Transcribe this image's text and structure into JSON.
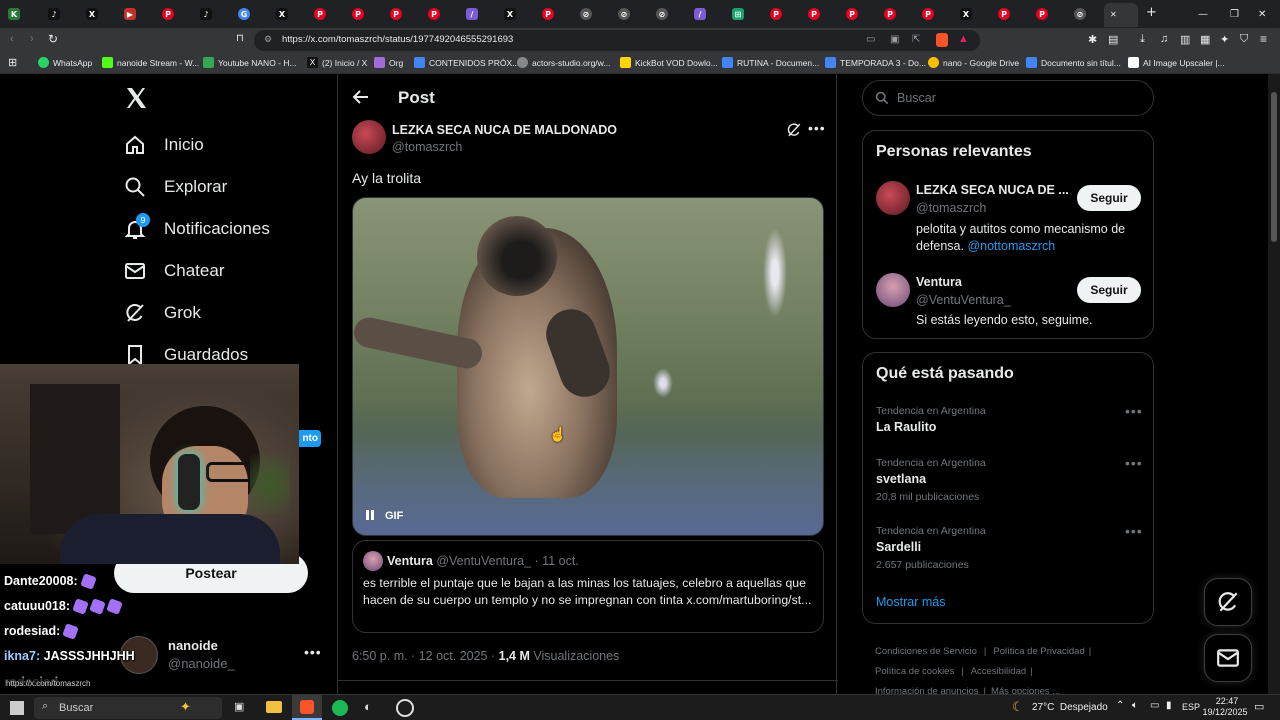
{
  "browser": {
    "url": "https://x.com/tomaszrch/status/1977492046555291693",
    "bookmarks": [
      "WhatsApp",
      "nanoide Stream - W...",
      "Youtube NANO - H...",
      "(2) Inicio / X",
      "Org",
      "CONTENIDOS PRÓX...",
      "actors-studio.org/w...",
      "KickBot VOD Dowlo...",
      "RUTINA - Documen...",
      "TEMPORADA 3 - Do...",
      "nano - Google Drive",
      "Documento sin títul...",
      "AI Image Upscaler |..."
    ]
  },
  "nav": {
    "items": [
      {
        "label": "Inicio",
        "icon": "home-icon"
      },
      {
        "label": "Explorar",
        "icon": "search-icon"
      },
      {
        "label": "Notificaciones",
        "icon": "bell-icon",
        "badge": "9"
      },
      {
        "label": "Chatear",
        "icon": "mail-icon"
      },
      {
        "label": "Grok",
        "icon": "grok-icon"
      },
      {
        "label": "Guardados",
        "icon": "bookmark-icon"
      }
    ],
    "post_button": "Postear",
    "badge_partial": "nto",
    "account": {
      "name": "nanoide",
      "handle": "@nanoide_"
    }
  },
  "post": {
    "header_title": "Post",
    "author_name": "LEZKA SECA NUCA DE MALDONADO",
    "author_handle": "@tomaszrch",
    "text": "Ay la trolita",
    "gif_label": "GIF",
    "quote": {
      "name": "Ventura",
      "handle": "@VentuVentura_",
      "date": "· 11 oct.",
      "text": "es terrible el puntaje que le bajan a las minas los tatuajes, celebro a aquellas que hacen de su cuerpo un templo y no se impregnan con tinta x.com/martuboring/st..."
    },
    "time": "6:50 p. m. · 12 oct. 2025 ·",
    "views_count": "1,4 M",
    "views_label": "Visualizaciones"
  },
  "sidebar": {
    "search_placeholder": "Buscar",
    "relevant_title": "Personas relevantes",
    "people": [
      {
        "name": "LEZKA SECA NUCA DE ...",
        "handle": "@tomaszrch",
        "bio": "pelotita y autitos como mecanismo de",
        "bio2": "defensa.",
        "bio_link": "@nottomaszrch",
        "button": "Seguir"
      },
      {
        "name": "Ventura",
        "handle": "@VentuVentura_",
        "bio": "Si estás leyendo esto, seguime.",
        "button": "Seguir"
      }
    ],
    "trending_title": "Qué está pasando",
    "trends": [
      {
        "meta": "Tendencia en Argentina",
        "name": "La Raulito",
        "count": ""
      },
      {
        "meta": "Tendencia en Argentina",
        "name": "svetlana",
        "count": "20,8 mil publicaciones"
      },
      {
        "meta": "Tendencia en Argentina",
        "name": "Sardelli",
        "count": "2.657 publicaciones"
      }
    ],
    "show_more": "Mostrar más",
    "footer": [
      "Condiciones de Servicio",
      "Política de Privacidad",
      "Política de cookies",
      "Accesibilidad",
      "Información de anuncios",
      "Más opciones ..."
    ]
  },
  "stream_chat": [
    {
      "user": "Dante20008:",
      "color": "#ffffff",
      "text": "",
      "emotes": 1
    },
    {
      "user": "catuuu018:",
      "color": "#ffffff",
      "text": "",
      "emotes": 3
    },
    {
      "user": "rodesiad:",
      "color": "#ffffff",
      "text": "",
      "emotes": 1
    },
    {
      "user": "ikna7:",
      "color": "#9ecbff",
      "text": "JASSSJHHJHH",
      "emotes": 0
    }
  ],
  "overlay_text": "rodesiad",
  "url_preview": "https://x.com/tomaszrch",
  "taskbar": {
    "search_placeholder": "Buscar",
    "weather": "27°C  Despejado",
    "lang": "ESP",
    "time": "22:47",
    "date": "19/12/2025"
  }
}
